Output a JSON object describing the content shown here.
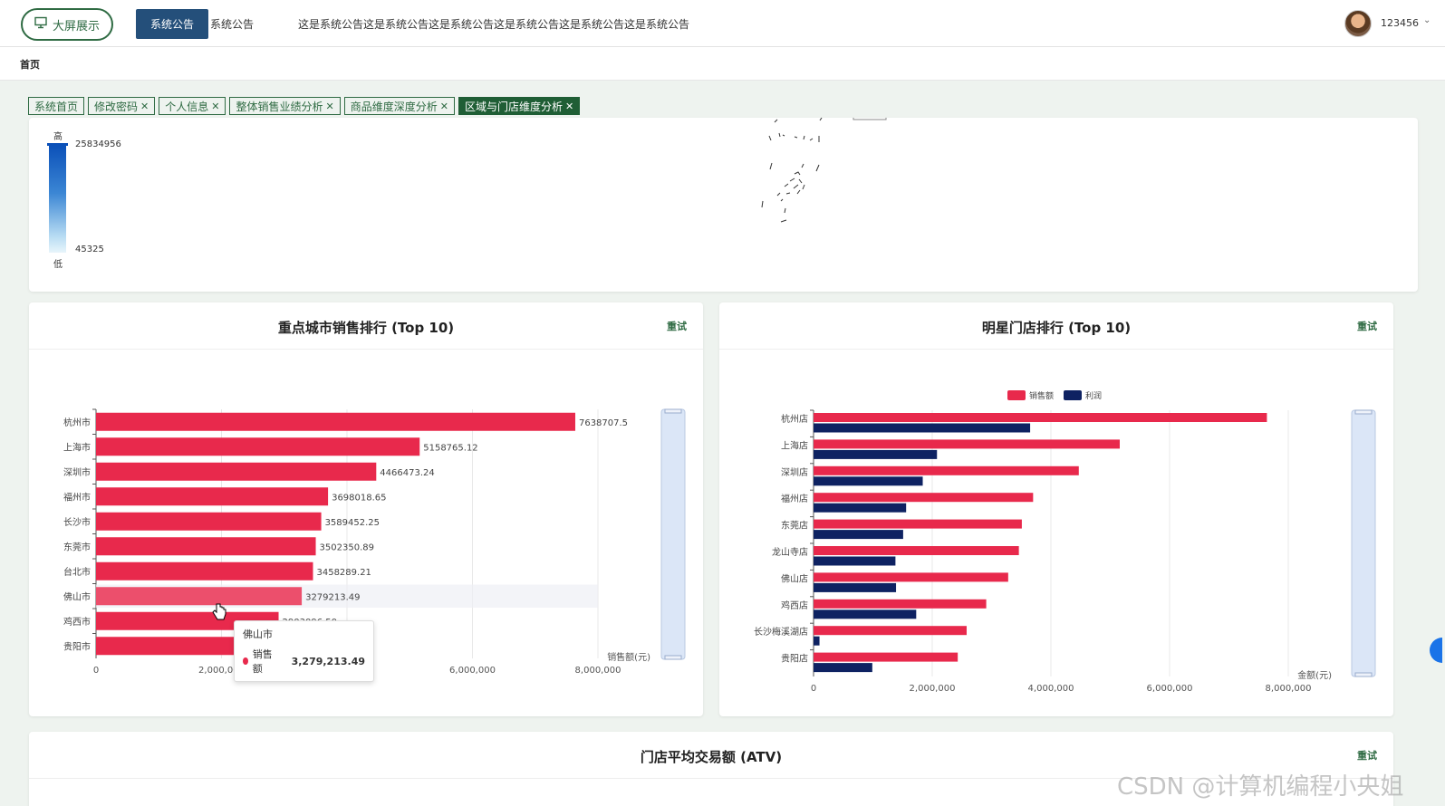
{
  "header": {
    "bigscreen_label": "大屏展示",
    "notice_label": "系统公告",
    "notice_tail": "系统公告",
    "notice_text": "这是系统公告这是系统公告这是系统公告这是系统公告这是系统公告这是系统公告",
    "username": "123456"
  },
  "breadcrumb": "首页",
  "tabs": [
    {
      "label": "系统首页",
      "closable": false
    },
    {
      "label": "修改密码",
      "closable": true
    },
    {
      "label": "个人信息",
      "closable": true
    },
    {
      "label": "整体销售业绩分析",
      "closable": true
    },
    {
      "label": "商品维度深度分析",
      "closable": true
    },
    {
      "label": "区域与门店维度分析",
      "closable": true,
      "active": true
    }
  ],
  "map": {
    "high_label": "高",
    "low_label": "低",
    "max_value": "25834956",
    "min_value": "45325"
  },
  "city_card": {
    "title": "重点城市销售排行 (Top 10)",
    "retry": "重试"
  },
  "store_card": {
    "title": "明星门店排行 (Top 10)",
    "retry": "重试"
  },
  "atv_card": {
    "title": "门店平均交易额 (ATV)",
    "retry": "重试"
  },
  "tooltip": {
    "city": "佛山市",
    "series": "销售额",
    "value": "3,279,213.49"
  },
  "watermark": "CSDN @计算机编程小央姐",
  "colors": {
    "sales": "#e8294c",
    "profit": "#0e2262",
    "accent": "#2f6b43"
  },
  "chart_data": [
    {
      "type": "bar",
      "orientation": "horizontal",
      "categories": [
        "杭州市",
        "上海市",
        "深圳市",
        "福州市",
        "长沙市",
        "东莞市",
        "台北市",
        "佛山市",
        "鸡西市",
        "贵阳市"
      ],
      "series": [
        {
          "name": "销售额",
          "values": [
            7638707.5,
            5158765.12,
            4466473.24,
            3698018.65,
            3589452.25,
            3502350.89,
            3458289.21,
            3279213.49,
            2910000,
            2710000
          ]
        }
      ],
      "data_labels": [
        "7638707.5",
        "5158765.12",
        "4466473.24",
        "3698018.65",
        "3589452.25",
        "3502350.89",
        "3458289.21",
        "3279213.49",
        "2903096.50",
        ""
      ],
      "xlabel": "销售额(元)",
      "xlim": [
        0,
        8000000
      ],
      "xticks": [
        "0",
        "2,000,000",
        "4,000,000",
        "6,000,000",
        "8,000,000"
      ],
      "highlight": "佛山市"
    },
    {
      "type": "bar",
      "orientation": "horizontal",
      "categories": [
        "杭州店",
        "上海店",
        "深圳店",
        "福州店",
        "东莞店",
        "龙山寺店",
        "佛山店",
        "鸡西店",
        "长沙梅溪湖店",
        "贵阳店"
      ],
      "series": [
        {
          "name": "销售额",
          "values": [
            7640000,
            5160000,
            4470000,
            3700000,
            3510000,
            3460000,
            3280000,
            2910000,
            2580000,
            2430000
          ]
        },
        {
          "name": "利润",
          "values": [
            3650000,
            2080000,
            1840000,
            1560000,
            1510000,
            1380000,
            1390000,
            1730000,
            100000,
            990000
          ]
        }
      ],
      "xlabel": "金额(元)",
      "xlim": [
        0,
        9000000
      ],
      "xticks": [
        "0",
        "2,000,000",
        "4,000,000",
        "6,000,000",
        "8,000,000"
      ],
      "legend": "top-center"
    }
  ]
}
